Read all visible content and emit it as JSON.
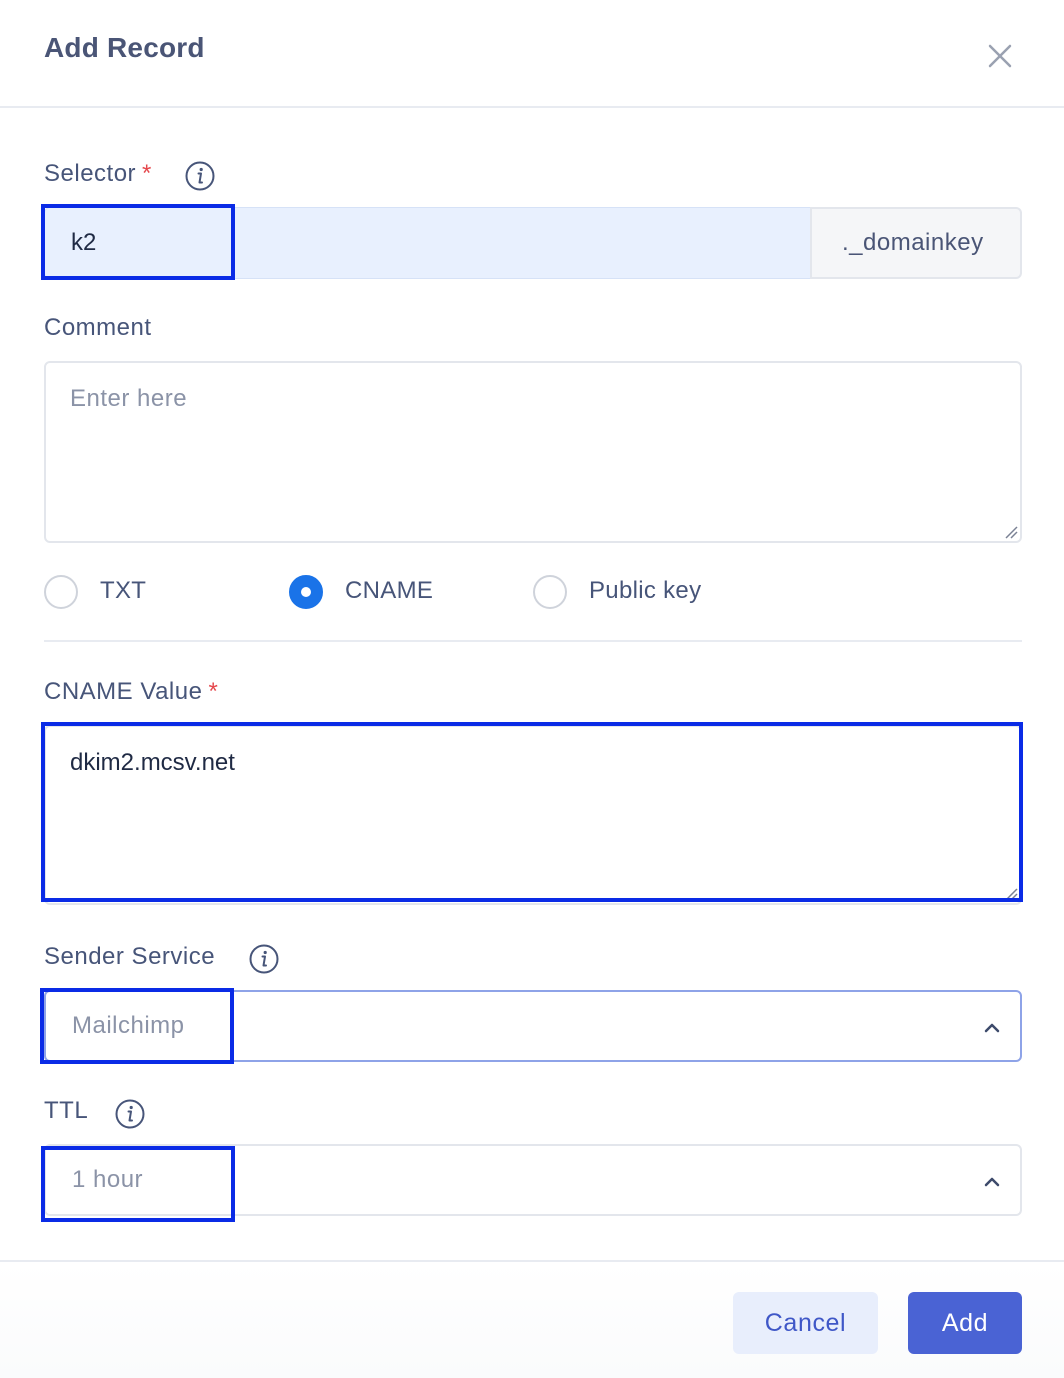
{
  "dialog": {
    "title": "Add Record",
    "close_icon": "close-icon"
  },
  "selector": {
    "label": "Selector",
    "required_mark": "*",
    "info_icon": "info-icon",
    "value": "k2",
    "suffix": "._domainkey"
  },
  "comment": {
    "label": "Comment",
    "placeholder": "Enter here",
    "value": ""
  },
  "record_type": {
    "options": [
      {
        "label": "TXT",
        "checked": false
      },
      {
        "label": "CNAME",
        "checked": true
      },
      {
        "label": "Public key",
        "checked": false
      }
    ]
  },
  "cname_value": {
    "label": "CNAME Value",
    "required_mark": "*",
    "value": "dkim2.mcsv.net"
  },
  "sender_service": {
    "label": "Sender Service",
    "info_icon": "info-icon",
    "value": "Mailchimp",
    "chevron_icon": "chevron-up-icon"
  },
  "ttl": {
    "label": "TTL",
    "info_icon": "info-icon",
    "value": "1 hour",
    "chevron_icon": "chevron-up-icon"
  },
  "footer": {
    "cancel_label": "Cancel",
    "add_label": "Add"
  },
  "colors": {
    "primary": "#4a63d4",
    "radio_checked": "#1a73e8",
    "required": "#e5484d",
    "highlight": "#0a2be6"
  }
}
